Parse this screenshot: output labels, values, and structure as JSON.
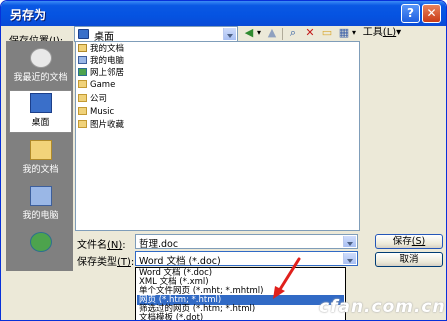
{
  "window": {
    "title": "另存为",
    "help_glyph": "?",
    "close_glyph": "✕"
  },
  "toolbar": {
    "save_in_label": "保存位置",
    "save_in_accel": "(I)",
    "save_in_value": "桌面",
    "tools_label": "工具",
    "tools_accel": "(L)",
    "tools_arrow": "▾",
    "back_glyph": "◀",
    "back_arrow": "▾",
    "up_glyph": "▲",
    "search_glyph": "⌕",
    "newfolder_glyph": "▭",
    "delete_glyph": "✕",
    "views_glyph": "▦",
    "views_arrow": "▾"
  },
  "places": [
    {
      "label": "我最近的文档",
      "icon": "recent-documents-icon"
    },
    {
      "label": "桌面",
      "icon": "desktop-icon"
    },
    {
      "label": "我的文档",
      "icon": "my-documents-icon"
    },
    {
      "label": "我的电脑",
      "icon": "my-computer-icon"
    },
    {
      "label": "",
      "icon": "network-places-icon"
    }
  ],
  "files": [
    {
      "name": "我的文档",
      "icon": "my-documents-icon"
    },
    {
      "name": "我的电脑",
      "icon": "my-computer-icon"
    },
    {
      "name": "网上邻居",
      "icon": "network-places-icon"
    },
    {
      "name": "Game",
      "icon": "folder-icon"
    },
    {
      "name": "公司",
      "icon": "folder-icon"
    },
    {
      "name": "Music",
      "icon": "folder-icon"
    },
    {
      "name": "图片收藏",
      "icon": "folder-icon"
    }
  ],
  "filename": {
    "label": "文件名",
    "accel": "(N)",
    "value": "哲理.doc"
  },
  "filetype": {
    "label": "保存类型",
    "accel": "(T)",
    "value": "Word 文档 (*.doc)",
    "options": [
      "Word 文档 (*.doc)",
      "XML 文档 (*.xml)",
      "单个文件网页 (*.mht; *.mhtml)",
      "网页 (*.htm; *.html)",
      "筛选过的网页 (*.htm; *.html)",
      "文档模板 (*.dot)"
    ],
    "highlighted_index": 3
  },
  "buttons": {
    "save": "保存",
    "save_accel": "(S)",
    "cancel": "取消"
  },
  "annotation": {
    "arrow_color": "#e0201c"
  },
  "watermark": "cfan.com.cn",
  "colors": {
    "titlebar": "#0553e1",
    "dialog_bg": "#ece9d8",
    "selection": "#316ac5"
  }
}
